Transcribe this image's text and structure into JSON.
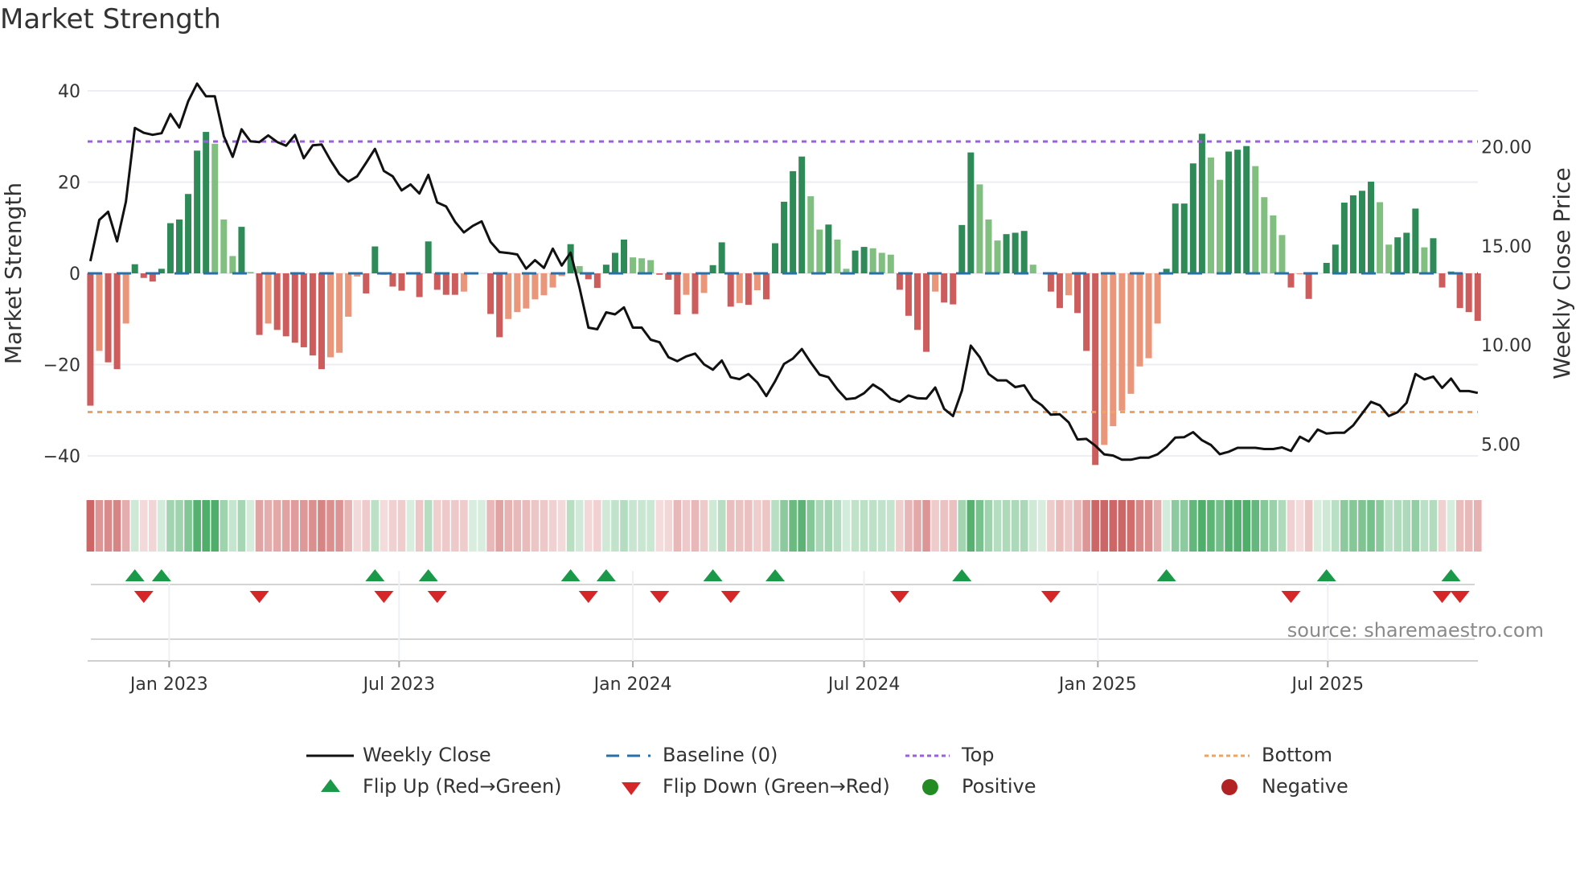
{
  "title": "Market Strength",
  "source": "source: sharemaestro.com",
  "legend": {
    "weekly_close": "Weekly Close",
    "baseline": "Baseline (0)",
    "top": "Top",
    "bottom": "Bottom",
    "flip_up": "Flip Up (Red→Green)",
    "flip_down": "Flip Down (Green→Red)",
    "positive": "Positive",
    "negative": "Negative"
  },
  "colors": {
    "pos_rising": "#2e8b57",
    "pos_falling": "#80bf80",
    "neg_falling": "#cd5c5c",
    "neg_rising": "#e9967a",
    "price": "#111111",
    "baseline": "#2a6fa8",
    "top": "#9b5fe0",
    "bottom": "#f0a35e",
    "flip_up": "#1a9a48",
    "flip_down": "#d62728",
    "positive": "#228b22",
    "negative": "#b22222"
  },
  "chart_data": {
    "type": "bar",
    "title": "Market Strength",
    "frequency": "weekly",
    "start_date": "2022-10-31",
    "ylabel": "Market Strength",
    "y2label": "Weekly Close Price",
    "ylim": [
      -45,
      45
    ],
    "y2lim": [
      3.25,
      25.5
    ],
    "yticks": [
      40,
      20,
      0,
      -20,
      -40
    ],
    "ytick_labels": [
      "40",
      "20",
      "0",
      "−20",
      "−40"
    ],
    "y2ticks": [
      20,
      15,
      10,
      5
    ],
    "y2tick_labels": [
      "20.00",
      "15.00",
      "10.00",
      "5.00"
    ],
    "xticks": [
      {
        "date": "2023-01-01",
        "label": "Jan 2023"
      },
      {
        "date": "2023-07-01",
        "label": "Jul 2023"
      },
      {
        "date": "2024-01-01",
        "label": "Jan 2024"
      },
      {
        "date": "2024-07-01",
        "label": "Jul 2024"
      },
      {
        "date": "2025-01-01",
        "label": "Jan 2025"
      },
      {
        "date": "2025-07-01",
        "label": "Jul 2025"
      }
    ],
    "top_level": 28.9,
    "bottom_level": -30.4,
    "strength": [
      -29,
      -17,
      -19.5,
      -21,
      -11,
      2,
      -1,
      -1.8,
      1,
      11,
      11.8,
      17.4,
      26.9,
      31,
      28.4,
      11.8,
      3.8,
      10.2,
      0.3,
      -13.5,
      -11,
      -12.4,
      -13.8,
      -15.2,
      -16.2,
      -18,
      -21,
      -18.4,
      -17.4,
      -9.5,
      -0.7,
      -4.4,
      5.9,
      -0.3,
      -2.9,
      -3.8,
      0,
      -5.2,
      7,
      -3.6,
      -4.7,
      -4.7,
      -4,
      0,
      0,
      -8.9,
      -14,
      -10,
      -8.5,
      -7.7,
      -5.7,
      -4.8,
      -3.1,
      -0.6,
      6.4,
      1.6,
      -1.3,
      -3.2,
      1.9,
      4.5,
      7.4,
      3.5,
      3.3,
      2.9,
      -0.3,
      -1.4,
      -9,
      -4.7,
      -8.9,
      -4.3,
      1.8,
      6.8,
      -7.3,
      -6.5,
      -6.9,
      -3.7,
      -5.7,
      6.6,
      15.7,
      22.4,
      25.6,
      16.9,
      9.6,
      10.7,
      7.4,
      1,
      5,
      5.8,
      5.5,
      4.5,
      4.1,
      -3.6,
      -9.3,
      -12.4,
      -17.2,
      -4,
      -6.4,
      -6.8,
      10.6,
      26.5,
      19.5,
      11.8,
      7.2,
      8.6,
      8.9,
      9.3,
      1.9,
      0,
      -4,
      -7.6,
      -4.8,
      -8.7,
      -17,
      -42,
      -37.6,
      -33.5,
      -30.1,
      -26.4,
      -20.4,
      -18.6,
      -11,
      1,
      15.3,
      15.3,
      24.1,
      30.6,
      25.4,
      20.5,
      26.7,
      27.1,
      27.9,
      23.5,
      16.7,
      12.7,
      8.4,
      -3.1,
      -0.2,
      -5.6,
      0,
      2.3,
      6.3,
      15.5,
      17.1,
      18.1,
      20.1,
      15.6,
      6.3,
      7.9,
      8.9,
      14.2,
      5.7,
      7.7,
      -3.1,
      0.4,
      -7.6,
      -8.5,
      -10.4
    ],
    "weekly_close": [
      14.23,
      16.31,
      16.72,
      15.23,
      17.23,
      20.95,
      20.7,
      20.6,
      20.68,
      21.65,
      20.97,
      22.3,
      23.18,
      22.54,
      22.54,
      20.54,
      19.49,
      20.88,
      20.27,
      20.23,
      20.57,
      20.24,
      20.05,
      20.59,
      19.42,
      20.07,
      20.11,
      19.32,
      18.62,
      18.24,
      18.51,
      19.19,
      19.89,
      18.78,
      18.51,
      17.8,
      18.1,
      17.64,
      18.58,
      17.19,
      16.99,
      16.22,
      15.68,
      16.01,
      16.24,
      15.2,
      14.69,
      14.64,
      14.57,
      13.85,
      14.28,
      13.89,
      14.86,
      14.01,
      14.66,
      12.9,
      10.88,
      10.8,
      11.65,
      11.55,
      11.9,
      10.88,
      10.88,
      10.27,
      10.14,
      9.39,
      9.19,
      9.43,
      9.57,
      9.03,
      8.76,
      9.22,
      8.38,
      8.28,
      8.54,
      8.11,
      7.43,
      8.18,
      9.05,
      9.32,
      9.8,
      9.12,
      8.51,
      8.38,
      7.77,
      7.27,
      7.32,
      7.57,
      8.01,
      7.73,
      7.3,
      7.14,
      7.46,
      7.32,
      7.3,
      7.86,
      6.78,
      6.42,
      7.7,
      9.97,
      9.39,
      8.54,
      8.22,
      8.22,
      7.88,
      7.97,
      7.27,
      6.96,
      6.49,
      6.51,
      6.11,
      5.24,
      5.27,
      4.93,
      4.49,
      4.43,
      4.22,
      4.22,
      4.32,
      4.32,
      4.49,
      4.86,
      5.34,
      5.36,
      5.61,
      5.2,
      4.96,
      4.5,
      4.62,
      4.82,
      4.82,
      4.82,
      4.76,
      4.76,
      4.84,
      4.66,
      5.38,
      5.14,
      5.74,
      5.54,
      5.58,
      5.58,
      5.95,
      6.55,
      7.14,
      6.96,
      6.42,
      6.62,
      7.09,
      8.54,
      8.27,
      8.41,
      7.84,
      8.31,
      7.68,
      7.68,
      7.59
    ],
    "flip_up_weeks": [
      5,
      8,
      32,
      38,
      54,
      58,
      70,
      77,
      98,
      121,
      139,
      153
    ],
    "flip_down_weeks": [
      6,
      19,
      33,
      39,
      56,
      64,
      72,
      91,
      108,
      135,
      152,
      154
    ],
    "grid": true
  }
}
